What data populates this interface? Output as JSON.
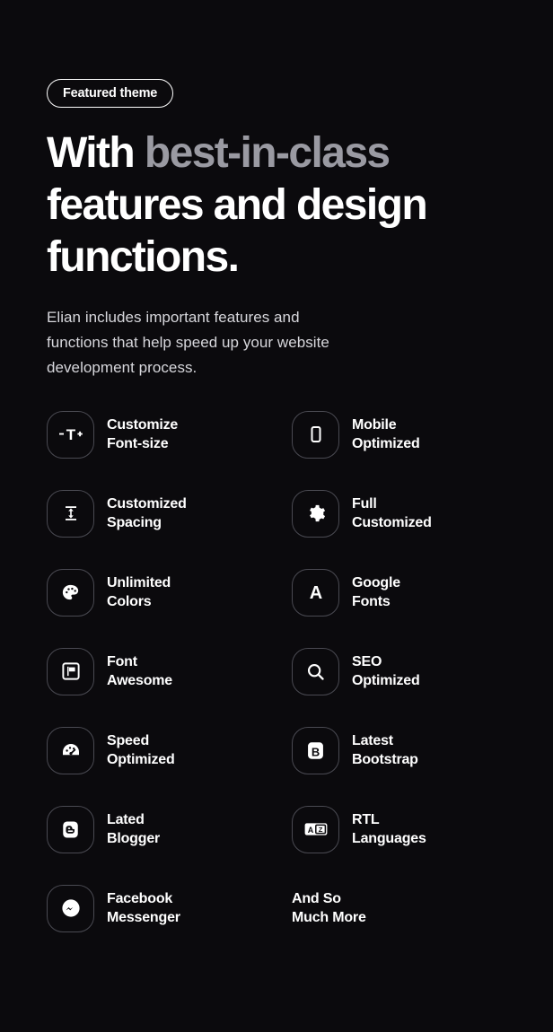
{
  "badge": {
    "label": "Featured theme"
  },
  "headline": {
    "part1": "With ",
    "highlight": "best-in-class",
    "part2": " features and design functions."
  },
  "paragraph": "Elian includes important features and functions that help speed up your website development process.",
  "features": [
    {
      "icon": "font-size-icon",
      "line1": "Customize",
      "line2": "Font-size"
    },
    {
      "icon": "mobile-icon",
      "line1": "Mobile",
      "line2": "Optimized"
    },
    {
      "icon": "line-spacing-icon",
      "line1": "Customized",
      "line2": "Spacing"
    },
    {
      "icon": "gear-icon",
      "line1": "Full",
      "line2": "Customized"
    },
    {
      "icon": "palette-icon",
      "line1": "Unlimited",
      "line2": "Colors"
    },
    {
      "icon": "letter-a-icon",
      "line1": "Google",
      "line2": "Fonts"
    },
    {
      "icon": "flag-square-icon",
      "line1": "Font",
      "line2": "Awesome"
    },
    {
      "icon": "search-icon",
      "line1": "SEO",
      "line2": "Optimized"
    },
    {
      "icon": "speedometer-icon",
      "line1": "Speed",
      "line2": "Optimized"
    },
    {
      "icon": "bootstrap-b-icon",
      "line1": "Latest",
      "line2": "Bootstrap"
    },
    {
      "icon": "blogger-icon",
      "line1": "Lated",
      "line2": "Blogger"
    },
    {
      "icon": "translate-icon",
      "line1": "RTL",
      "line2": "Languages"
    },
    {
      "icon": "messenger-icon",
      "line1": "Facebook",
      "line2": "Messenger"
    },
    {
      "icon": "none",
      "line1": "And So",
      "line2": "Much More"
    }
  ],
  "colors": {
    "background": "#0b0a0d",
    "text_primary": "#ffffff",
    "text_muted": "#9a9aa2",
    "text_body": "#d7d7dc",
    "icon_border": "#4a4a52"
  }
}
